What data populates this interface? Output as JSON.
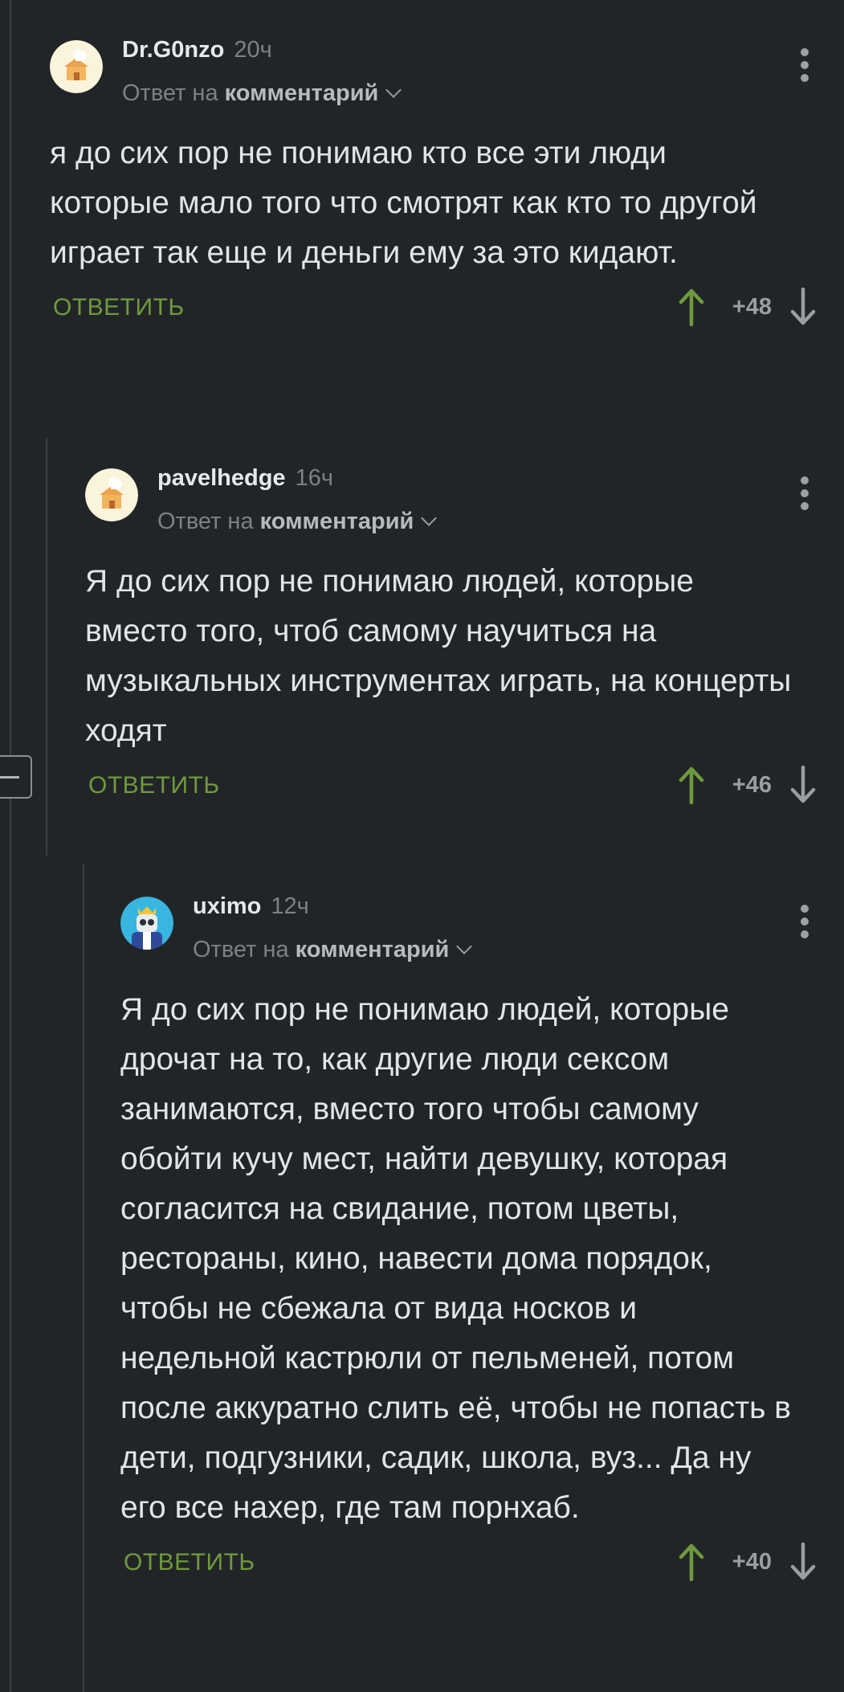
{
  "comments": [
    {
      "author": "Dr.G0nzo",
      "time": "20ч",
      "reply_prefix": "Ответ на",
      "reply_link": "комментарий",
      "text": "я до сих пор не понимаю кто все эти люди которые мало того что смотрят как кто то другой играет так еще и деньги ему за это кидают.",
      "reply_label": "ОТВЕТИТЬ",
      "score": "+48"
    },
    {
      "author": "pavelhedge",
      "time": "16ч",
      "reply_prefix": "Ответ на",
      "reply_link": "комментарий",
      "text": "Я до сих пор не понимаю людей, которые вместо того, чтоб самому научиться на музыкальных инструментах играть, на концерты ходят",
      "reply_label": "ОТВЕТИТЬ",
      "score": "+46"
    },
    {
      "author": "uximo",
      "time": "12ч",
      "reply_prefix": "Ответ на",
      "reply_link": "комментарий",
      "text": "Я до сих пор не понимаю людей, которые дрочат на то, как другие люди сексом занимаются, вместо того чтобы самому обойти кучу мест, найти девушку, которая согласится на свидание, потом цветы, рестораны, кино, навести дома порядок, чтобы не сбежала от вида носков и недельной кастрюли от пельменей, потом после аккуратно слить её, чтобы не попасть в дети, подгузники, садик, школа, вуз... Да ну его все нахер, где там порнхаб.",
      "reply_label": "ОТВЕТИТЬ",
      "score": "+40"
    }
  ],
  "colors": {
    "background": "#222528",
    "reply_green": "#6f9a3e",
    "upvote_green": "#6f9a3e",
    "muted": "#7d8185"
  },
  "icons": [
    "avatar-chef-house",
    "avatar-crowned-robot",
    "more-vertical-icon",
    "chevron-down-icon",
    "arrow-up-icon",
    "arrow-down-icon",
    "collapse-minus-icon"
  ]
}
